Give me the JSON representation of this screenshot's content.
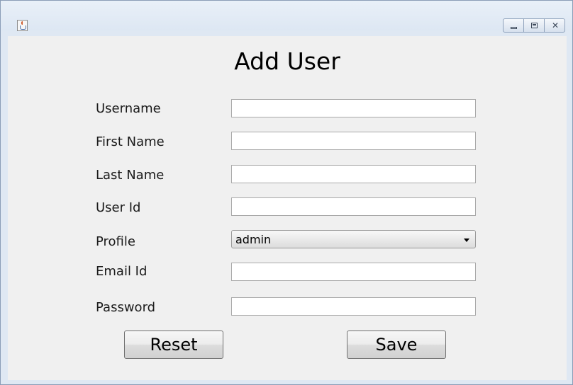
{
  "window": {
    "icon": "java-cup-icon",
    "controls": [
      "minimize-icon",
      "maximize-icon",
      "close-icon"
    ]
  },
  "form": {
    "title": "Add User",
    "fields": [
      {
        "label": "Username",
        "value": ""
      },
      {
        "label": "First Name",
        "value": ""
      },
      {
        "label": "Last Name",
        "value": ""
      },
      {
        "label": "User Id",
        "value": ""
      },
      {
        "label": "Profile",
        "selected": "admin"
      },
      {
        "label": "Email Id",
        "value": ""
      },
      {
        "label": "Password",
        "value": ""
      }
    ],
    "buttons": {
      "reset": "Reset",
      "save": "Save"
    }
  }
}
